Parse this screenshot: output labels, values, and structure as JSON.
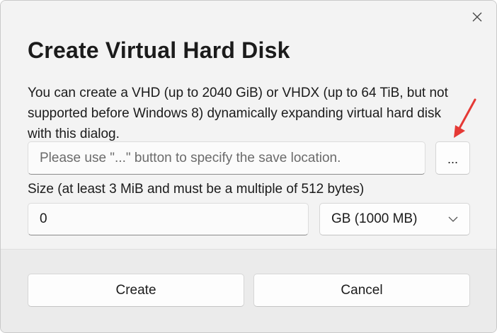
{
  "dialog": {
    "title": "Create Virtual Hard Disk",
    "description": "You can create a VHD (up to 2040 GiB) or VHDX (up to 64 TiB, but not supported before Windows 8) dynamically expanding virtual hard disk with this dialog."
  },
  "location": {
    "value": "",
    "placeholder": "Please use \"...\" button to specify the save location.",
    "browse_label": "..."
  },
  "size": {
    "label": "Size (at least 3 MiB and must be a multiple of 512 bytes)",
    "value": "0",
    "unit_selected": "GB (1000 MB)"
  },
  "buttons": {
    "create_label": "Create",
    "cancel_label": "Cancel"
  },
  "icons": {
    "close": "close-icon",
    "dropdown": "chevron-down-icon",
    "annotation": "red-arrow-annotation"
  },
  "colors": {
    "annotation_red": "#e53935",
    "dialog_bg": "#f3f3f3",
    "footer_bg": "#ebebeb"
  }
}
